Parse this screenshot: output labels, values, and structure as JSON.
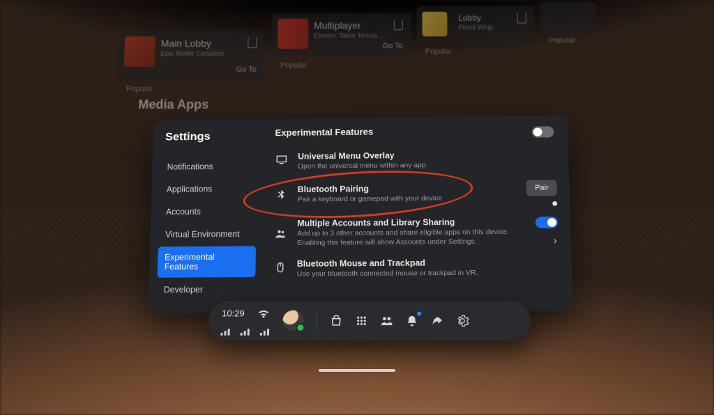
{
  "background": {
    "section_heading": "Media Apps",
    "cards": [
      {
        "title": "Main Lobby",
        "subtitle": "Epic Roller Coasters",
        "go": "Go To",
        "tag": "Popular"
      },
      {
        "title": "Multiplayer",
        "subtitle": "Eleven: Table Tennis ...",
        "go": "Go To",
        "tag": "Popular"
      },
      {
        "title": "Lobby",
        "subtitle": "Pistol Whip",
        "go": "",
        "tag": "Popular"
      },
      {
        "title": "",
        "subtitle": "",
        "go": "",
        "tag": "Popular"
      }
    ]
  },
  "settings": {
    "title": "Settings",
    "nav": [
      "Notifications",
      "Applications",
      "Accounts",
      "Virtual Environment",
      "Experimental Features",
      "Developer"
    ],
    "active_index": 4,
    "section_title": "Experimental Features",
    "master_toggle": false,
    "items": [
      {
        "icon": "monitor",
        "title": "Universal Menu Overlay",
        "desc": "Open the universal menu within any app."
      },
      {
        "icon": "bluetooth",
        "title": "Bluetooth Pairing",
        "desc": "Pair a keyboard or gamepad with your device",
        "action_label": "Pair"
      },
      {
        "icon": "people",
        "title": "Multiple Accounts and Library Sharing",
        "desc": "Add up to 3 other accounts and share eligible apps on this device. Enabling this feature will show Accounts under Settings.",
        "toggle": true,
        "chevron": true
      },
      {
        "icon": "mouse",
        "title": "Bluetooth Mouse and Trackpad",
        "desc": "Use your bluetooth connected mouse or trackpad in VR."
      }
    ]
  },
  "dock": {
    "time": "10:29",
    "status_online": true
  }
}
